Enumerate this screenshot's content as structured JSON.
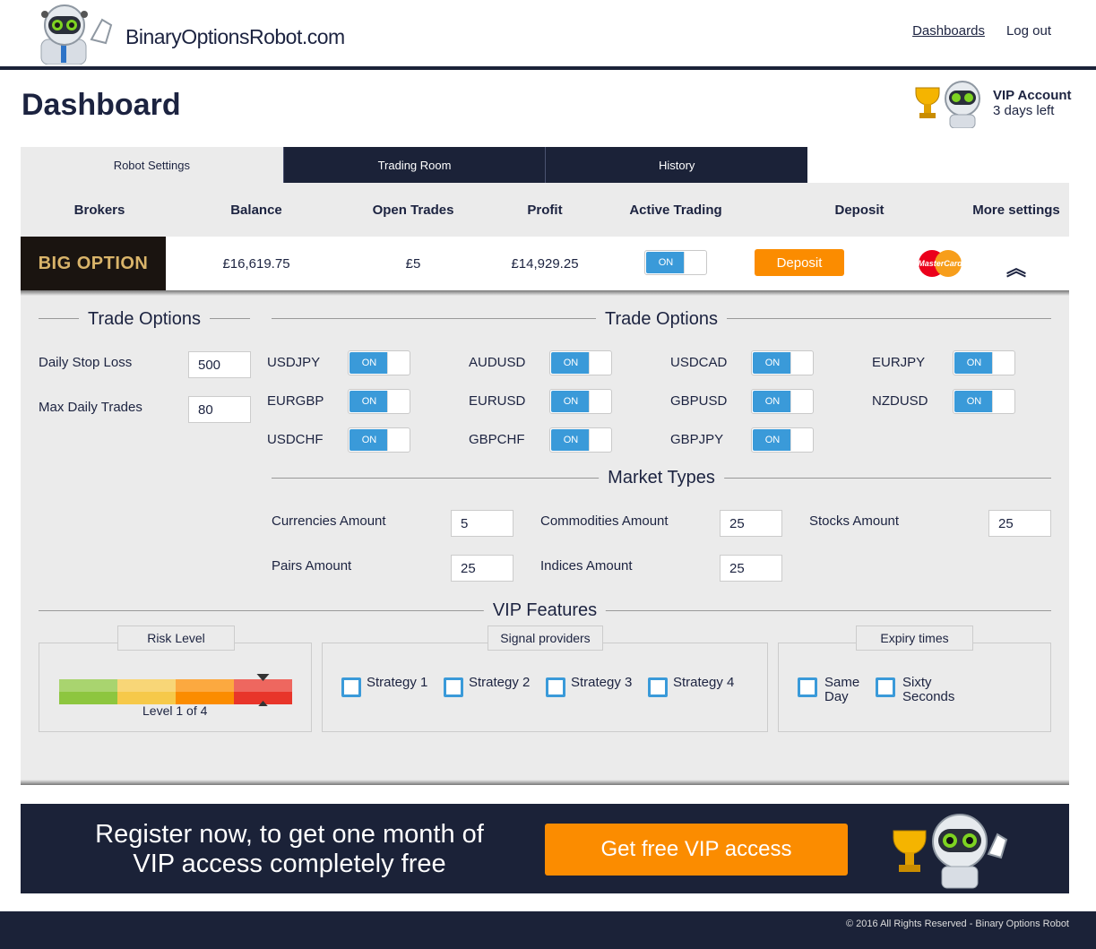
{
  "header": {
    "logo_text": "BinaryOptionsRobot.com",
    "nav": [
      "Dashboards",
      "Log out"
    ]
  },
  "page_title": "Dashboard",
  "vip": {
    "title": "VIP Account",
    "days": "3 days left"
  },
  "tabs": [
    "Robot Settings",
    "Trading Room",
    "History"
  ],
  "table": {
    "headers": [
      "Brokers",
      "Balance",
      "Open Trades",
      "Profit",
      "Active Trading",
      "Deposit",
      "More settings"
    ],
    "row": {
      "broker": "BIG OPTION",
      "balance": "£16,619.75",
      "open_trades": "£5",
      "profit": "£14,929.25",
      "active": "ON",
      "deposit_label": "Deposit",
      "card": "MasterCard"
    }
  },
  "trade_options_left": {
    "title": "Trade Options",
    "stop_loss_label": "Daily Stop Loss",
    "stop_loss": "500",
    "max_trades_label": "Max Daily Trades",
    "max_trades": "80"
  },
  "trade_options": {
    "title": "Trade Options",
    "pairs": [
      {
        "name": "USDJPY",
        "state": "ON"
      },
      {
        "name": "AUDUSD",
        "state": "ON"
      },
      {
        "name": "USDCAD",
        "state": "ON"
      },
      {
        "name": "EURJPY",
        "state": "ON"
      },
      {
        "name": "EURGBP",
        "state": "ON"
      },
      {
        "name": "EURUSD",
        "state": "ON"
      },
      {
        "name": "GBPUSD",
        "state": "ON"
      },
      {
        "name": "NZDUSD",
        "state": "ON"
      },
      {
        "name": "USDCHF",
        "state": "ON"
      },
      {
        "name": "GBPCHF",
        "state": "ON"
      },
      {
        "name": "GBPJPY",
        "state": "ON"
      }
    ]
  },
  "market_types": {
    "title": "Market Types",
    "items": [
      {
        "label": "Currencies Amount",
        "value": "5"
      },
      {
        "label": "Commodities Amount",
        "value": "25"
      },
      {
        "label": "Stocks Amount",
        "value": "25"
      },
      {
        "label": "Pairs Amount",
        "value": "25"
      },
      {
        "label": "Indices Amount",
        "value": "25"
      }
    ]
  },
  "vip_features": {
    "title": "VIP Features",
    "risk": {
      "title": "Risk Level",
      "level_text": "Level 1 of 4",
      "level": 4,
      "colors": [
        "#8dc63f",
        "#f6c94a",
        "#fb8c00",
        "#e8352a"
      ]
    },
    "signals": {
      "title": "Signal providers",
      "items": [
        "Strategy 1",
        "Strategy 2",
        "Strategy 3",
        "Strategy 4"
      ]
    },
    "expiry": {
      "title": "Expiry times",
      "items": [
        "Same Day",
        "Sixty Seconds"
      ]
    }
  },
  "banner": {
    "text": "Register now, to get one month of VIP access completely free",
    "button": "Get free VIP access"
  },
  "footer": "© 2016 All Rights Reserved - Binary Options Robot"
}
